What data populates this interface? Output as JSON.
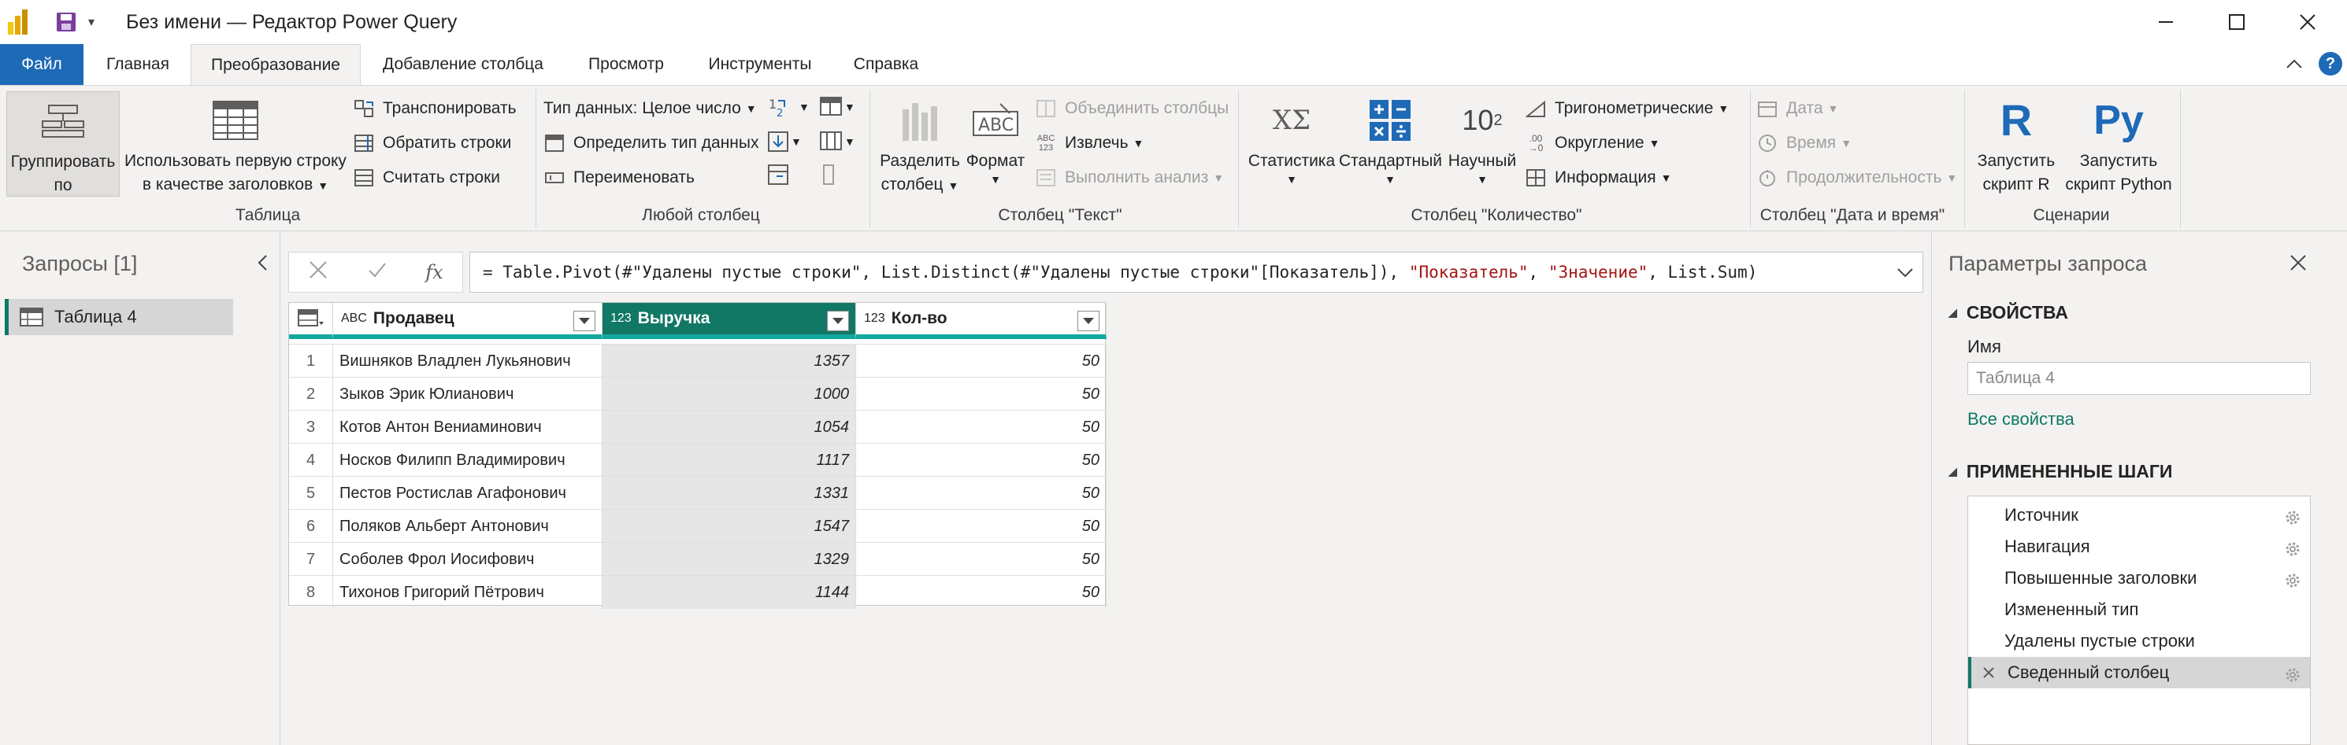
{
  "window": {
    "title": "Без имени — Редактор Power Query"
  },
  "tabs": {
    "file": "Файл",
    "home": "Главная",
    "transform": "Преобразование",
    "add_column": "Добавление столбца",
    "view": "Просмотр",
    "tools": "Инструменты",
    "help": "Справка",
    "help_icon": "?"
  },
  "ribbon": {
    "table": {
      "label": "Таблица",
      "group_by_line1": "Группировать",
      "group_by_line2": "по",
      "first_row_line1": "Использовать первую строку",
      "first_row_line2": "в качестве заголовков",
      "transpose": "Транспонировать",
      "reverse_rows": "Обратить строки",
      "count_rows": "Считать строки"
    },
    "any_column": {
      "label": "Любой столбец",
      "data_type": "Тип данных: Целое число",
      "detect_type": "Определить тип данных",
      "rename": "Переименовать"
    },
    "text_column": {
      "label": "Столбец \"Текст\"",
      "split_line1": "Разделить",
      "split_line2": "столбец",
      "format": "Формат",
      "merge_columns": "Объединить столбцы",
      "extract": "Извлечь",
      "parse": "Выполнить анализ",
      "abc_123": "ABC\n123"
    },
    "number_column": {
      "label": "Столбец \"Количество\"",
      "statistics": "Статистика",
      "standard": "Стандартный",
      "scientific": "Научный",
      "scientific_icon": "10",
      "scientific_sup": "2",
      "trigonometry": "Тригонометрические",
      "rounding": "Округление",
      "information": "Информация"
    },
    "datetime_column": {
      "label": "Столбец \"Дата и время\"",
      "date": "Дата",
      "time": "Время",
      "duration": "Продолжительность"
    },
    "scripts": {
      "label": "Сценарии",
      "run_r_line1": "Запустить",
      "run_r_line2": "скрипт R",
      "run_r_icon": "R",
      "run_python_line1": "Запустить",
      "run_python_line2": "скрипт Python",
      "run_python_icon": "Py"
    }
  },
  "queries": {
    "title": "Запросы [1]",
    "items": [
      "Таблица 4"
    ]
  },
  "formula": {
    "fx": "fx",
    "prefix": "= Table.Pivot(#\"Удалены пустые строки\", List.Distinct(#\"Удалены пустые строки\"[Показатель]), ",
    "arg1": "\"Показатель\"",
    "sep1": ", ",
    "arg2": "\"Значение\"",
    "suffix": ", List.Sum)"
  },
  "grid": {
    "columns": [
      {
        "name": "Продавец",
        "type_icon": "ABC"
      },
      {
        "name": "Выручка",
        "type_icon": "123"
      },
      {
        "name": "Кол-во",
        "type_icon": "123"
      }
    ],
    "rows": [
      {
        "n": "1",
        "seller": "Вишняков Владлен Лукьянович",
        "revenue": "1357",
        "qty": "50"
      },
      {
        "n": "2",
        "seller": "Зыков Эрик Юлианович",
        "revenue": "1000",
        "qty": "50"
      },
      {
        "n": "3",
        "seller": "Котов Антон Вениаминович",
        "revenue": "1054",
        "qty": "50"
      },
      {
        "n": "4",
        "seller": "Носков Филипп Владимирович",
        "revenue": "1117",
        "qty": "50"
      },
      {
        "n": "5",
        "seller": "Пестов Ростислав Агафонович",
        "revenue": "1331",
        "qty": "50"
      },
      {
        "n": "6",
        "seller": "Поляков Альберт Антонович",
        "revenue": "1547",
        "qty": "50"
      },
      {
        "n": "7",
        "seller": "Соболев Фрол Иосифович",
        "revenue": "1329",
        "qty": "50"
      },
      {
        "n": "8",
        "seller": "Тихонов Григорий Пётрович",
        "revenue": "1144",
        "qty": "50"
      }
    ]
  },
  "settings": {
    "title": "Параметры запроса",
    "properties_header": "СВОЙСТВА",
    "name_label": "Имя",
    "name_value": "Таблица 4",
    "all_properties": "Все свойства",
    "steps_header": "ПРИМЕНЕННЫЕ ШАГИ",
    "steps": [
      {
        "label": "Источник",
        "gear": true,
        "active": false
      },
      {
        "label": "Навигация",
        "gear": true,
        "active": false
      },
      {
        "label": "Повышенные заголовки",
        "gear": true,
        "active": false
      },
      {
        "label": "Измененный тип",
        "gear": false,
        "active": false
      },
      {
        "label": "Удалены пустые строки",
        "gear": false,
        "active": false
      },
      {
        "label": "Сведенный столбец",
        "gear": true,
        "active": true
      }
    ]
  },
  "colors": {
    "accent_teal": "#117865",
    "file_tab_blue": "#1e6ab7",
    "header_underline": "#13a89e",
    "string_literal": "#a31515"
  }
}
